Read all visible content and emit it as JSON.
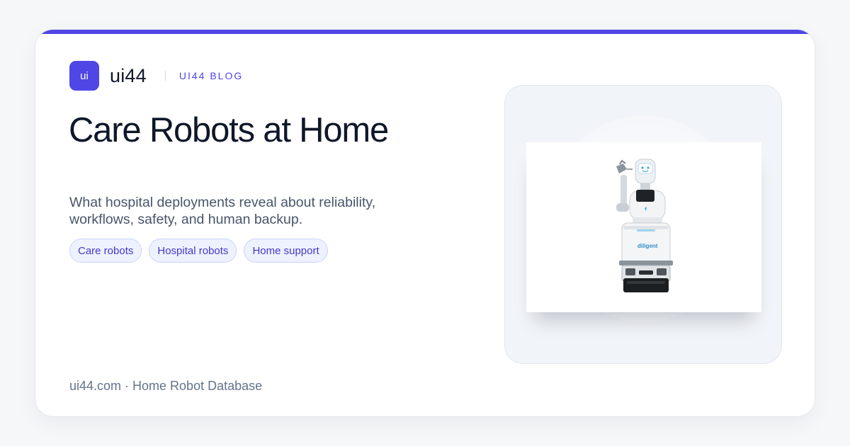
{
  "brand": {
    "logo_text": "ui",
    "name": "ui44",
    "section": "UI44 BLOG"
  },
  "article": {
    "title": "Care Robots at Home",
    "subtitle": "What hospital deployments reveal about reliability, workflows, safety, and human backup.",
    "tags": [
      "Care robots",
      "Hospital robots",
      "Home support"
    ]
  },
  "image": {
    "robot_logo": "diligent"
  },
  "footer": {
    "text": "ui44.com · Home Robot Database"
  },
  "colors": {
    "accent": "#4f46e5",
    "tag_background": "#eef2ff",
    "tag_border": "#c7d2fe",
    "title": "#0f172a",
    "subtitle": "#475569",
    "footer": "#64748b"
  }
}
